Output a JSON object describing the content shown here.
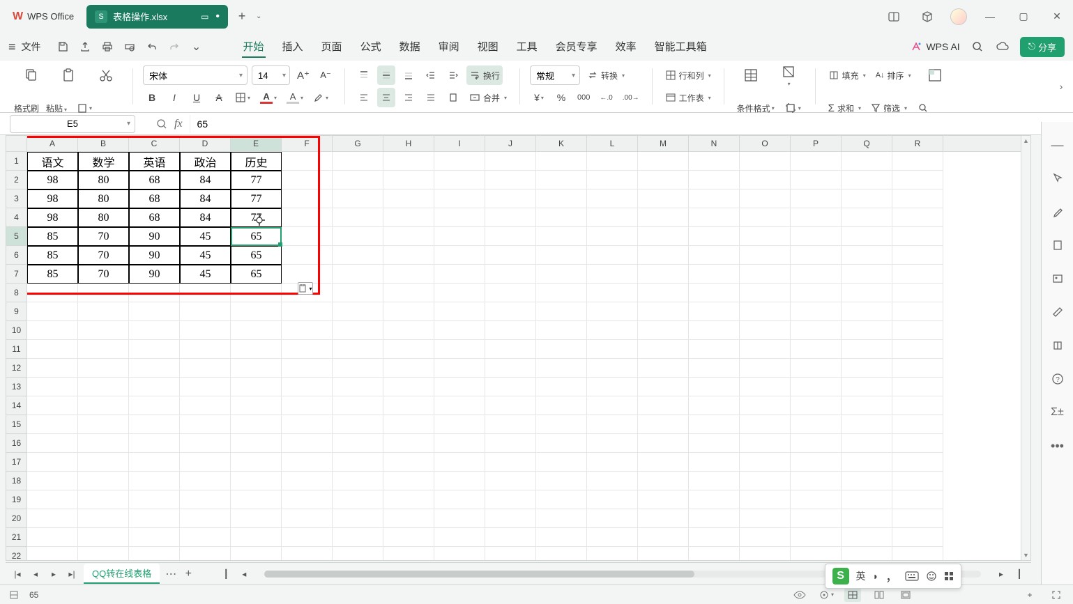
{
  "app": {
    "name": "WPS Office"
  },
  "tab": {
    "icon": "S",
    "filename": "表格操作.xlsx"
  },
  "menu": {
    "file": "文件",
    "tabs": [
      "开始",
      "插入",
      "页面",
      "公式",
      "数据",
      "审阅",
      "视图",
      "工具",
      "会员专享",
      "效率",
      "智能工具箱"
    ],
    "active_index": 0,
    "wps_ai": "WPS AI",
    "share": "分享"
  },
  "ribbon": {
    "format_painter": "格式刷",
    "paste": "粘贴",
    "font_name": "宋体",
    "font_size": "14",
    "wrap_text": "换行",
    "merge": "合并",
    "number_format": "常规",
    "convert": "转换",
    "rows_cols": "行和列",
    "worksheet": "工作表",
    "conditional": "条件格式",
    "fill": "填充",
    "sort": "排序",
    "sum": "求和",
    "filter": "筛选"
  },
  "formula_bar": {
    "cell_ref": "E5",
    "value": "65"
  },
  "grid": {
    "columns": [
      "A",
      "B",
      "C",
      "D",
      "E",
      "F",
      "G",
      "H",
      "I",
      "J",
      "K",
      "L",
      "M",
      "N",
      "O",
      "P",
      "Q",
      "R"
    ],
    "selected_col_index": 4,
    "selected_row_index": 4,
    "row_count": 23,
    "data": [
      [
        "语文",
        "数学",
        "英语",
        "政治",
        "历史"
      ],
      [
        "98",
        "80",
        "68",
        "84",
        "77"
      ],
      [
        "98",
        "80",
        "68",
        "84",
        "77"
      ],
      [
        "98",
        "80",
        "68",
        "84",
        "77"
      ],
      [
        "85",
        "70",
        "90",
        "45",
        "65"
      ],
      [
        "85",
        "70",
        "90",
        "45",
        "65"
      ],
      [
        "85",
        "70",
        "90",
        "45",
        "65"
      ]
    ]
  },
  "sheet_tabs": {
    "active": "QQ转在线表格"
  },
  "status": {
    "value": "65"
  },
  "ime": {
    "lang": "英"
  }
}
